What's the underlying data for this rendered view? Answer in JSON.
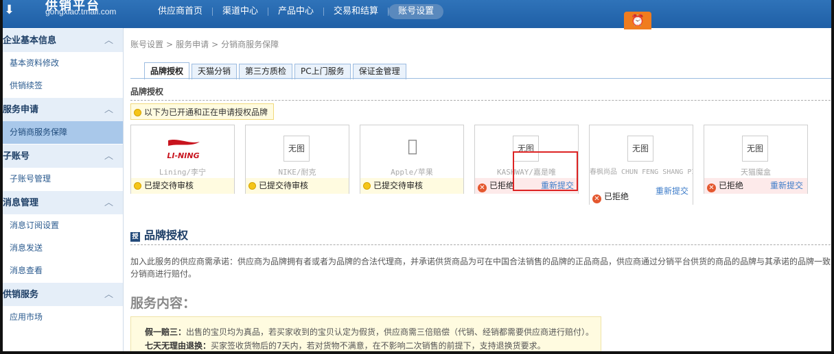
{
  "header": {
    "logo_text": "供销平台",
    "logo_domain": "gongxiao.tmall.com",
    "nav": [
      "供应商首页",
      "渠道中心",
      "产品中心",
      "交易和结算",
      "账号设置"
    ],
    "active_nav": "账号设置"
  },
  "sidebar": {
    "groups": [
      {
        "title": "企业基本信息",
        "items": [
          "基本资料修改",
          "供销续签"
        ]
      },
      {
        "title": "服务申请",
        "items": [
          "分销商服务保障"
        ]
      },
      {
        "title": "子账号",
        "items": [
          "子账号管理"
        ]
      },
      {
        "title": "消息管理",
        "items": [
          "消息订阅设置",
          "消息发送",
          "消息查看"
        ]
      },
      {
        "title": "供销服务",
        "items": [
          "应用市场"
        ]
      }
    ],
    "active_item": "分销商服务保障"
  },
  "breadcrumb": [
    "账号设置",
    "服务申请",
    "分销商服务保障"
  ],
  "tabs": [
    "品牌授权",
    "天猫分销",
    "第三方质检",
    "PC上门服务",
    "保证金管理"
  ],
  "active_tab": "品牌授权",
  "section_title": "品牌授权",
  "notice": "以下为已开通和正在申请授权品牌",
  "brands": [
    {
      "image": "LI-NING",
      "name": "Lining/李宁",
      "status": "已提交待审核",
      "state": "pending"
    },
    {
      "image": "无图",
      "name": "NIKE/耐克",
      "status": "已提交待审核",
      "state": "pending"
    },
    {
      "image": "apple-logo",
      "name": "Apple/苹果",
      "status": "已提交待审核",
      "state": "pending"
    },
    {
      "image": "无图",
      "name": "KASHWAY/嘉是唯",
      "status": "已拒绝",
      "state": "rejected",
      "action": "重新提交"
    },
    {
      "image": "无图",
      "name": "春枫尚品 CHUN FENG SHANG PIN",
      "status": "已拒绝",
      "state": "rejected",
      "action": "重新提交"
    },
    {
      "image": "无图",
      "name": "天猫魔盒",
      "status": "已拒绝",
      "state": "rejected",
      "action": "重新提交"
    }
  ],
  "brand_auth": {
    "title": "品牌授权",
    "description": "加入此服务的供应商需承诺：供应商为品牌拥有者或者为品牌的合法代理商，并承诺供货商品为可在中国合法销售的品牌的正品商品，供应商通过分销平台供货的商品的品牌与其承诺的品牌一致",
    "description_line2": "分销商进行赔付。",
    "service_title": "服务内容：",
    "services": [
      {
        "label": "假一赔三：",
        "text": "出售的宝贝均为真品，若买家收到的宝贝认定为假货，供应商需三倍赔偿（代销、经销都需要供应商进行赔付）。"
      },
      {
        "label": "七天无理由退换：",
        "text": "买家签收货物后的7天内，若对货物不满意，在不影响二次销售的前提下，支持退换货要求。"
      }
    ]
  },
  "colors": {
    "topbar": "#2468ae",
    "accent_orange": "#f07c1e",
    "link": "#3d7cc9",
    "highlight": "#d22222"
  }
}
